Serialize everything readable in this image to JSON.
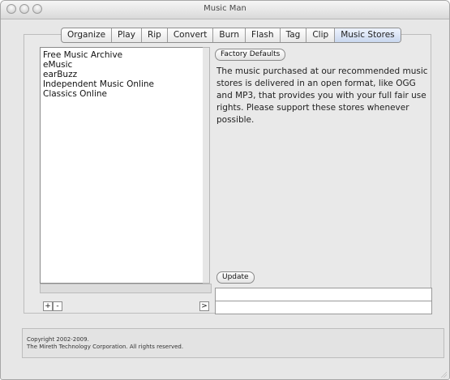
{
  "window": {
    "title": "Music Man"
  },
  "tabs": [
    {
      "label": "Organize",
      "active": false
    },
    {
      "label": "Play",
      "active": false
    },
    {
      "label": "Rip",
      "active": false
    },
    {
      "label": "Convert",
      "active": false
    },
    {
      "label": "Burn",
      "active": false
    },
    {
      "label": "Flash",
      "active": false
    },
    {
      "label": "Tag",
      "active": false
    },
    {
      "label": "Clip",
      "active": false
    },
    {
      "label": "Music Stores",
      "active": true
    }
  ],
  "stores": {
    "items": [
      "Free Music Archive",
      "eMusic",
      "earBuzz",
      "Independent Music Online",
      "Classics Online"
    ],
    "add_label": "+",
    "remove_label": "-",
    "go_label": ">"
  },
  "details": {
    "factory_defaults_label": "Factory Defaults",
    "description": "The music purchased at our recommended music stores is delivered in an open format, like OGG and MP3, that provides you with your full fair use rights. Please support these stores whenever possible.",
    "update_label": "Update",
    "field1_value": "",
    "field2_value": ""
  },
  "footer": {
    "copyright_line1": "Copyright 2002-2009.",
    "copyright_line2": "The Mireth Technology Corporation. All rights reserved."
  }
}
